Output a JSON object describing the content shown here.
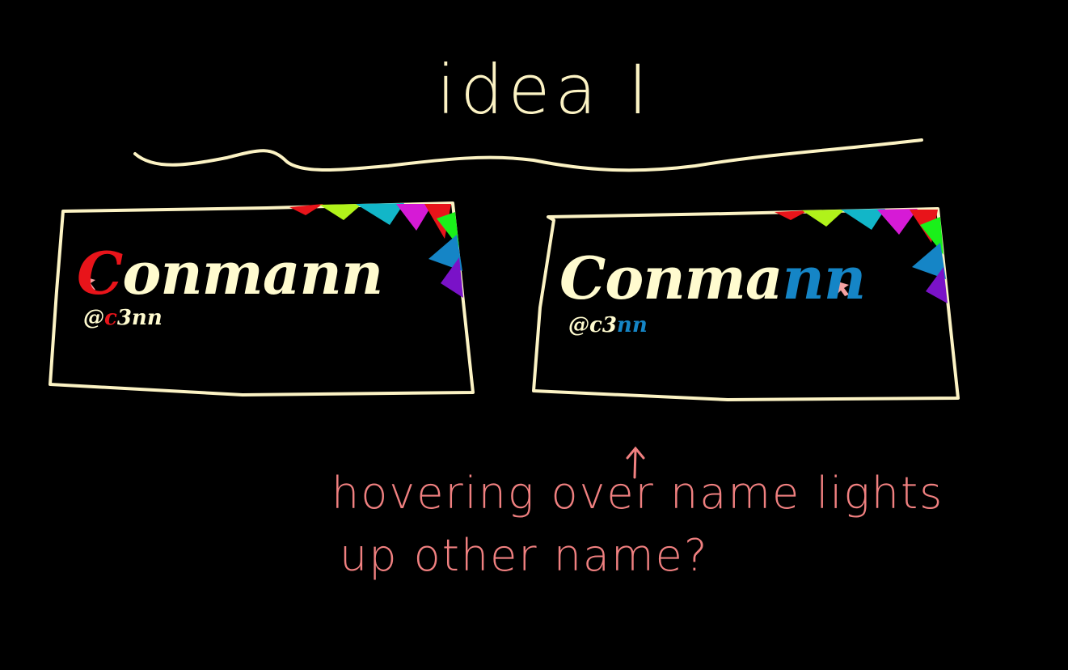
{
  "title": "idea I",
  "card_left": {
    "name_first": "C",
    "name_rest": "onmann",
    "handle_prefix": "@",
    "handle_highlight": "c",
    "handle_rest": "3nn"
  },
  "card_right": {
    "name_plain": "Conma",
    "name_highlight": "nn",
    "handle_plain": "@c3",
    "handle_highlight": "nn"
  },
  "note": {
    "line1": "hovering over name lights",
    "line2": "up other name?"
  },
  "colors": {
    "ink": "#fcf3c4",
    "note": "#f08080",
    "highlight_red": "#e8141a",
    "highlight_blue": "#1585c6",
    "rainbow": [
      "#e8141a",
      "#b0f21a",
      "#12b6c8",
      "#d61ad6",
      "#e8141a",
      "#1af01a",
      "#1585c6",
      "#7a12c8"
    ]
  }
}
